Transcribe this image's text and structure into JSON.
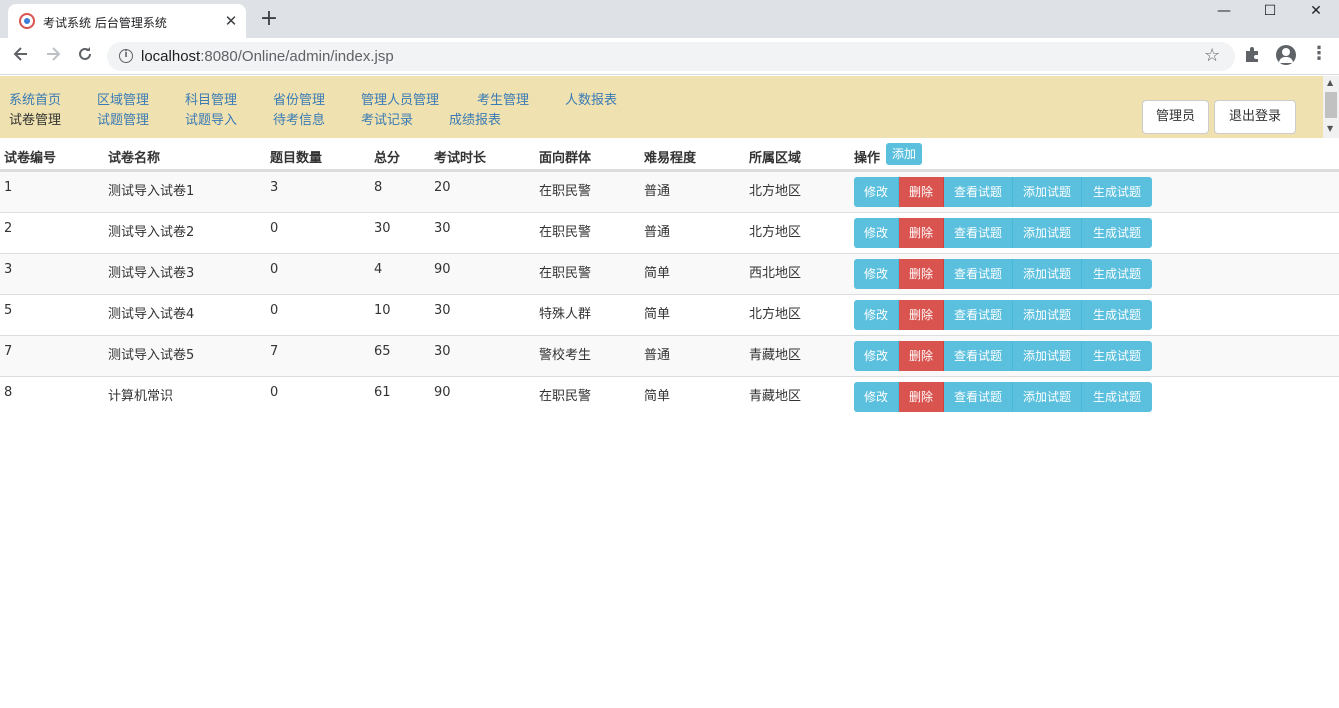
{
  "browser": {
    "tab_title": "考试系统 后台管理系统",
    "tab_close": "✕",
    "new_tab": "+",
    "url_host": "localhost",
    "url_path": ":8080/Online/admin/index.jsp",
    "window_controls": {
      "minimize": "—",
      "maximize": "☐",
      "close": "✕"
    },
    "icons": [
      "back-icon",
      "forward-icon",
      "reload-icon",
      "info-icon",
      "star-icon",
      "extension-icon",
      "profile-icon",
      "menu-icon"
    ]
  },
  "nav": {
    "row1": [
      "系统首页",
      "区域管理",
      "科目管理",
      "省份管理",
      "管理人员管理",
      "考生管理",
      "人数报表"
    ],
    "row2": [
      "试卷管理",
      "试题管理",
      "试题导入",
      "待考信息",
      "考试记录",
      "成绩报表"
    ],
    "admin_button": "管理员",
    "logout_button": "退出登录"
  },
  "table": {
    "headers": [
      "试卷编号",
      "试卷名称",
      "题目数量",
      "总分",
      "考试时长",
      "面向群体",
      "难易程度",
      "所属区域",
      "操作"
    ],
    "add_button": "添加",
    "action_labels": {
      "edit": "修改",
      "delete": "删除",
      "view": "查看试题",
      "add": "添加试题",
      "generate": "生成试题"
    },
    "rows": [
      [
        "1",
        "测试导入试卷1",
        "3",
        "8",
        "20",
        "在职民警",
        "普通",
        "北方地区"
      ],
      [
        "2",
        "测试导入试卷2",
        "0",
        "30",
        "30",
        "在职民警",
        "普通",
        "北方地区"
      ],
      [
        "3",
        "测试导入试卷3",
        "0",
        "4",
        "90",
        "在职民警",
        "简单",
        "西北地区"
      ],
      [
        "5",
        "测试导入试卷4",
        "0",
        "10",
        "30",
        "特殊人群",
        "简单",
        "北方地区"
      ],
      [
        "7",
        "测试导入试卷5",
        "7",
        "65",
        "30",
        "警校考生",
        "普通",
        "青藏地区"
      ],
      [
        "8",
        "计算机常识",
        "0",
        "61",
        "90",
        "在职民警",
        "简单",
        "青藏地区"
      ]
    ]
  },
  "colors": {
    "header_bg": "#efe1b0",
    "link": "#3a7bb5",
    "info_btn": "#5bc0de",
    "danger_btn": "#d9534f"
  }
}
